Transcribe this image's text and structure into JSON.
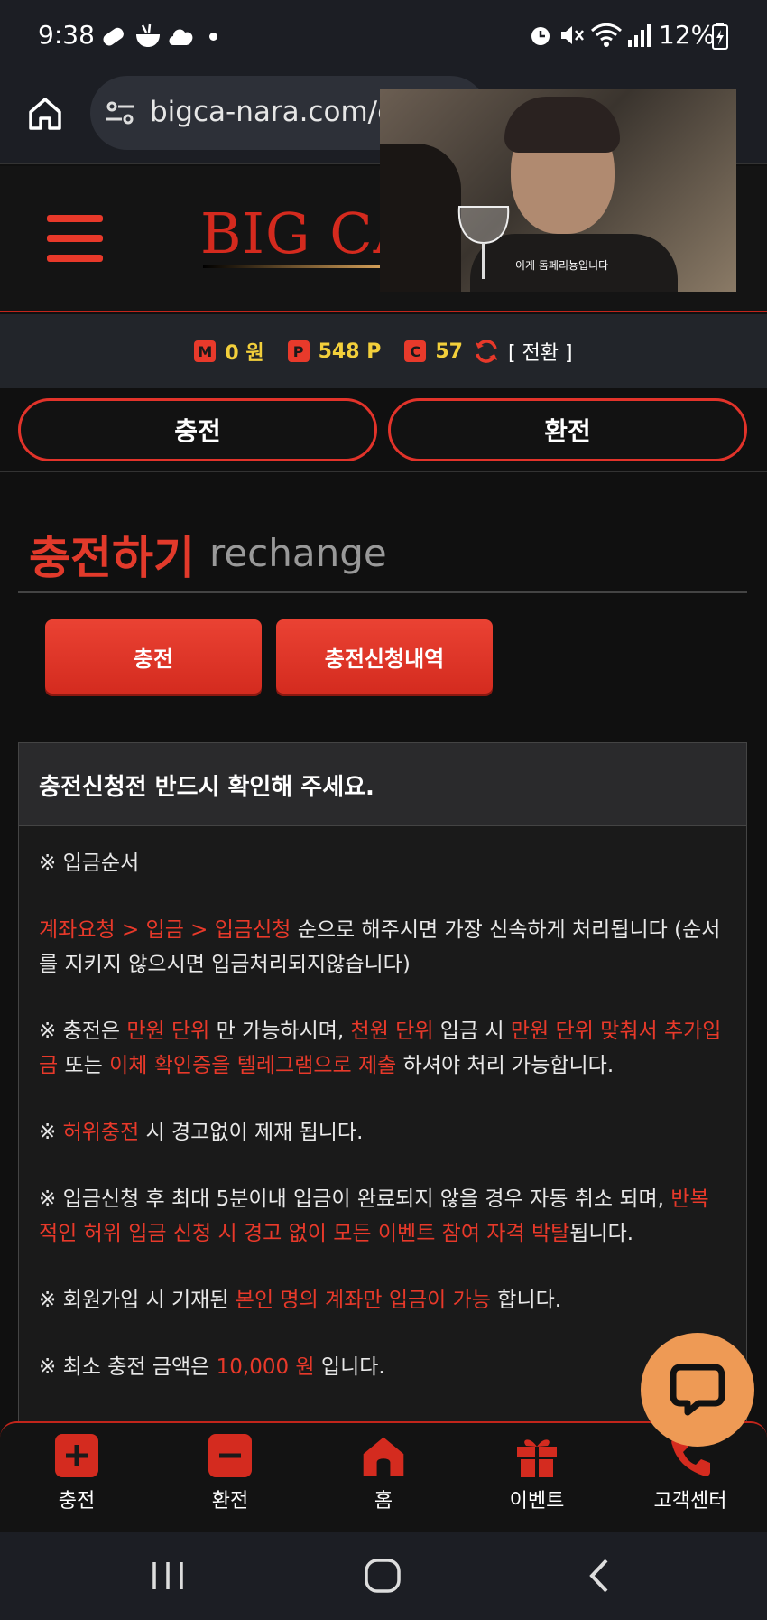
{
  "status_bar": {
    "time": "9:38",
    "battery": "12%",
    "icons": [
      "link-icon",
      "bowl-icon",
      "cloud-icon",
      "dot-icon",
      "alarm-icon",
      "mute-icon",
      "wifi-icon",
      "signal-icon",
      "battery-icon"
    ]
  },
  "browser": {
    "url": "bigca-nara.com/c",
    "icons": [
      "home-icon",
      "site-settings-icon"
    ]
  },
  "video": {
    "subtitle": "이게 돔페리뇽입니다"
  },
  "header": {
    "logo": "BIG CA"
  },
  "points": {
    "m_badge": "M",
    "m_value": "0 원",
    "p_badge": "P",
    "p_value": "548 P",
    "c_badge": "C",
    "c_value": "57",
    "switch_label": "[ 전환 ]"
  },
  "tabs": {
    "charge": "충전",
    "exchange": "환전"
  },
  "section": {
    "title": "충전하기",
    "subtitle": "rechange"
  },
  "actions": {
    "charge": "충전",
    "history": "충전신청내역"
  },
  "notice": {
    "heading": "충전신청전 반드시 확인해 주세요.",
    "p1": "※ 입금순서",
    "p2_hl": "계좌요청 > 입금 > 입금신청",
    "p2_rest": " 순으로 해주시면 가장 신속하게 처리됩니다 (순서를 지키지 않으시면 입금처리되지않습니다)",
    "p3_a": "※ 충전은 ",
    "p3_hl1": "만원 단위",
    "p3_b": " 만 가능하시며, ",
    "p3_hl2": "천원 단위",
    "p3_c": " 입금 시 ",
    "p3_hl3": "만원 단위 맞춰서 추가입금",
    "p3_d": " 또는 ",
    "p3_hl4": "이체 확인증을 텔레그램으로 제출",
    "p3_e": " 하셔야 처리 가능합니다.",
    "p4_a": "※ ",
    "p4_hl": "허위충전",
    "p4_b": " 시 경고없이 제재 됩니다.",
    "p5_a": "※ 입금신청 후 최대 5분이내 입금이 완료되지 않을 경우 자동 취소 되며, ",
    "p5_hl": "반복적인 허위 입금 신청 시 경고 없이 모든 이벤트 참여 자격 박탈",
    "p5_b": "됩니다.",
    "p6_a": "※ 회원가입 시 기재된 ",
    "p6_hl": "본인 명의 계좌만 입금이 가능",
    "p6_b": " 합니다.",
    "p7_a": "※ 최소 충전 금액은 ",
    "p7_hl": "10,000 원",
    "p7_b": " 입니다."
  },
  "bottom_nav": {
    "items": [
      {
        "label": "충전",
        "icon": "plus-icon"
      },
      {
        "label": "환전",
        "icon": "minus-icon"
      },
      {
        "label": "홈",
        "icon": "home-icon"
      },
      {
        "label": "이벤트",
        "icon": "gift-icon"
      },
      {
        "label": "고객센터",
        "icon": "phone-icon"
      }
    ]
  },
  "colors": {
    "accent": "#e8392a",
    "points_value": "#f2cf3b",
    "chat_fab": "#ee9a55"
  }
}
